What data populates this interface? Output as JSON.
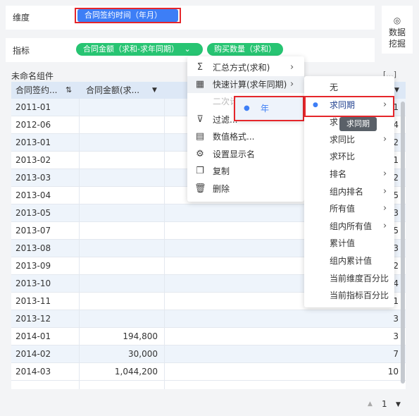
{
  "fields": {
    "dimension_label": "维度",
    "dimension_pill": "合同签约时间（年月）",
    "metric_label": "指标",
    "metric_pill_1": "合同金额（求和-求年同期）",
    "metric_pill_2": "购买数量（求和）",
    "mining_button": "数据\n挖掘",
    "mining_line1": "数据",
    "mining_line2": "挖掘"
  },
  "component": {
    "title": "未命名组件",
    "more": "[...]"
  },
  "table": {
    "headers": [
      "合同签约...",
      "合同金额(求...",
      ""
    ],
    "rows": [
      {
        "date": "2011-01",
        "amount": "",
        "count": "1"
      },
      {
        "date": "2012-06",
        "amount": "",
        "count": "4"
      },
      {
        "date": "2013-01",
        "amount": "",
        "count": "2"
      },
      {
        "date": "2013-02",
        "amount": "",
        "count": "1"
      },
      {
        "date": "2013-03",
        "amount": "",
        "count": "2"
      },
      {
        "date": "2013-04",
        "amount": "",
        "count": "5"
      },
      {
        "date": "2013-05",
        "amount": "",
        "count": "3"
      },
      {
        "date": "2013-07",
        "amount": "",
        "count": "5"
      },
      {
        "date": "2013-08",
        "amount": "",
        "count": "3"
      },
      {
        "date": "2013-09",
        "amount": "",
        "count": "2"
      },
      {
        "date": "2013-10",
        "amount": "",
        "count": "4"
      },
      {
        "date": "2013-11",
        "amount": "",
        "count": "1"
      },
      {
        "date": "2013-12",
        "amount": "",
        "count": "3"
      },
      {
        "date": "2014-01",
        "amount": "194,800",
        "count": "3"
      },
      {
        "date": "2014-02",
        "amount": "30,000",
        "count": "7"
      },
      {
        "date": "2014-03",
        "amount": "1,044,200",
        "count": "10"
      }
    ]
  },
  "menu1": {
    "items": [
      "汇总方式(求和)",
      "快速计算(求年同期)",
      "二次计算",
      "过滤...",
      "数值格式...",
      "设置显示名",
      "复制",
      "删除"
    ]
  },
  "menu_year": {
    "item": "年"
  },
  "menu2": {
    "items": [
      "无",
      "求同期",
      "求",
      "求同比",
      "求环比",
      "排名",
      "组内排名",
      "所有值",
      "组内所有值",
      "累计值",
      "组内累计值",
      "当前维度百分比",
      "当前指标百分比"
    ]
  },
  "tooltip": "求同期",
  "pagination": {
    "page": "1"
  },
  "colors": {
    "pill_green": "#27c472",
    "pill_blue": "#3d7ef6",
    "highlight_red": "#e5262b",
    "header_bg": "#dde8f6"
  }
}
